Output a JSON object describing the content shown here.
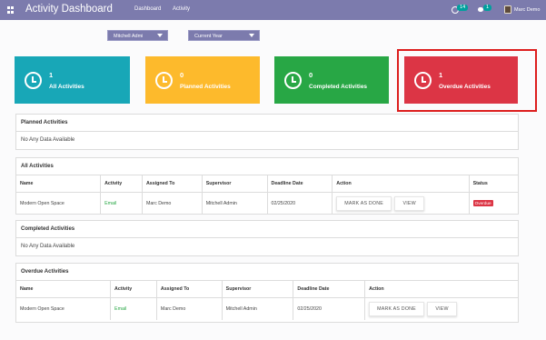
{
  "header": {
    "app_title": "Activity Dashboard",
    "nav": [
      "Dashboard",
      "Activity"
    ],
    "activity_badge": "14",
    "message_badge": "1",
    "user_name": "Marc Demo"
  },
  "filters": {
    "user": "Mitchell Admi",
    "period": "Current Year"
  },
  "cards": [
    {
      "count": "1",
      "label": "All Activities",
      "color": "#18a7b7"
    },
    {
      "count": "0",
      "label": "Planned Activities",
      "color": "#fdba2c"
    },
    {
      "count": "0",
      "label": "Completed Activities",
      "color": "#28a745"
    },
    {
      "count": "1",
      "label": "Overdue Activities",
      "color": "#dc3545"
    }
  ],
  "planned": {
    "title": "Planned Activities",
    "empty_text": "No Any Data Available"
  },
  "all": {
    "title": "All Activities",
    "columns": [
      "Name",
      "Activity",
      "Assigned To",
      "Supervisor",
      "Deadline Date",
      "Action",
      "Status"
    ],
    "rows": [
      {
        "name": "Modern Open Space",
        "activity": "Email",
        "assigned_to": "Marc Demo",
        "supervisor": "Mitchell Admin",
        "deadline": "02/25/2020",
        "mark_done": "MARK AS DONE",
        "view": "VIEW",
        "status": "Overdue"
      }
    ]
  },
  "completed": {
    "title": "Completed Activities",
    "empty_text": "No Any Data Available"
  },
  "overdue": {
    "title": "Overdue Activities",
    "columns": [
      "Name",
      "Activity",
      "Assigned To",
      "Supervisor",
      "Deadline Date",
      "Action"
    ],
    "rows": [
      {
        "name": "Modern Open Space",
        "activity": "Email",
        "assigned_to": "Marc Demo",
        "supervisor": "Mitchell Admin",
        "deadline": "02/25/2020",
        "mark_done": "MARK AS DONE",
        "view": "VIEW"
      }
    ]
  },
  "colors": {
    "navbar": "#7c7bad",
    "accent_link": "#28a745",
    "overdue": "#dc3545"
  }
}
